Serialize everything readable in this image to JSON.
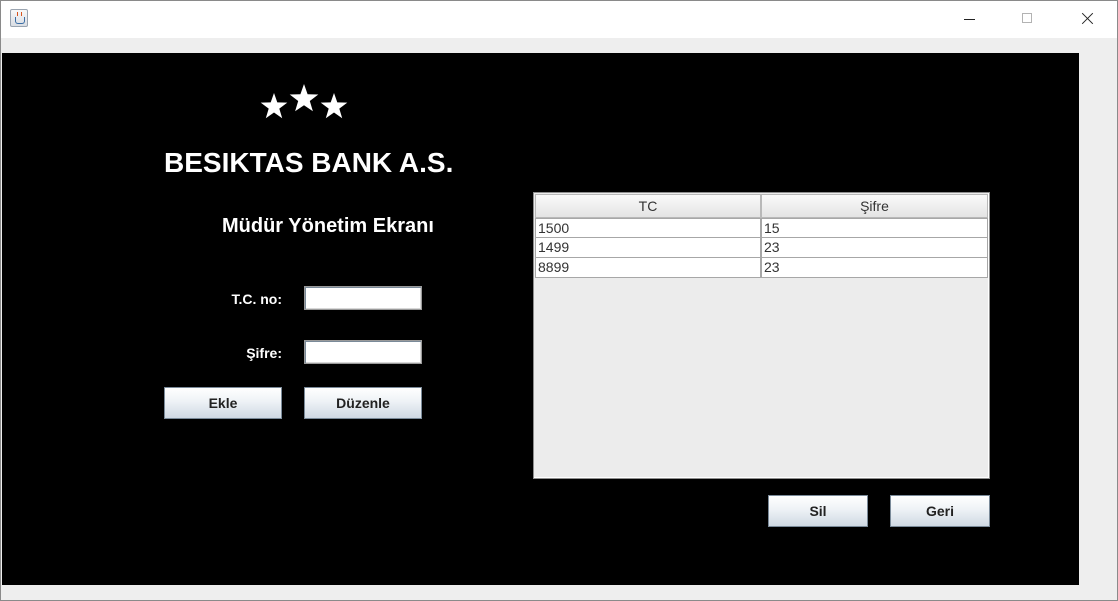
{
  "window": {
    "title": ""
  },
  "header": {
    "title": "BESIKTAS BANK A.S.",
    "subtitle": "Müdür Yönetim Ekranı"
  },
  "form": {
    "tc_label": "T.C. no:",
    "sifre_label": "Şifre:",
    "tc_value": "",
    "sifre_value": "",
    "ekle_label": "Ekle",
    "duzenle_label": "Düzenle"
  },
  "table": {
    "columns": [
      "TC",
      "Şifre"
    ],
    "rows": [
      [
        "1500",
        "15"
      ],
      [
        "1499",
        "23"
      ],
      [
        "8899",
        "23"
      ]
    ]
  },
  "actions": {
    "sil_label": "Sil",
    "geri_label": "Geri"
  },
  "colors": {
    "panel_background": "#000000",
    "text_light": "#ffffff"
  },
  "icons": {
    "logo": "three-stars-icon",
    "app": "java-cup-icon",
    "minimize": "minimize-icon",
    "maximize": "maximize-icon",
    "close": "close-icon"
  }
}
